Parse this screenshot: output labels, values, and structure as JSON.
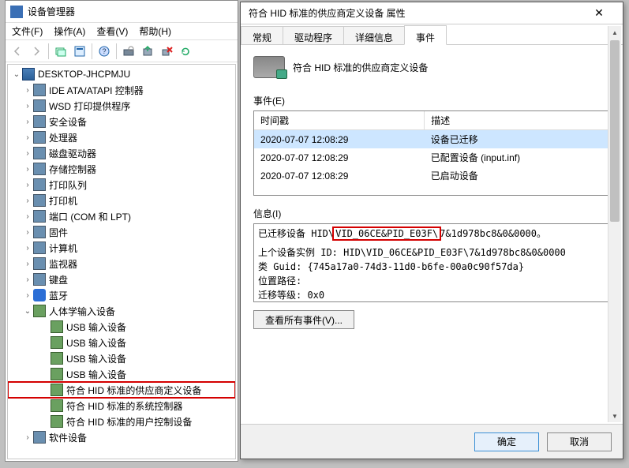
{
  "dm": {
    "title": "设备管理器",
    "menu": {
      "file": "文件(F)",
      "action": "操作(A)",
      "view": "查看(V)",
      "help": "帮助(H)"
    },
    "root": "DESKTOP-JHCPMJU",
    "categories": [
      {
        "label": "IDE ATA/ATAPI 控制器",
        "expand": "›"
      },
      {
        "label": "WSD 打印提供程序",
        "expand": "›"
      },
      {
        "label": "安全设备",
        "expand": "›"
      },
      {
        "label": "处理器",
        "expand": "›"
      },
      {
        "label": "磁盘驱动器",
        "expand": "›"
      },
      {
        "label": "存储控制器",
        "expand": "›"
      },
      {
        "label": "打印队列",
        "expand": "›"
      },
      {
        "label": "打印机",
        "expand": "›"
      },
      {
        "label": "端口 (COM 和 LPT)",
        "expand": "›"
      },
      {
        "label": "固件",
        "expand": "›"
      },
      {
        "label": "计算机",
        "expand": "›"
      },
      {
        "label": "监视器",
        "expand": "›"
      },
      {
        "label": "键盘",
        "expand": "›"
      },
      {
        "label": "蓝牙",
        "expand": "›"
      },
      {
        "label": "人体学输入设备",
        "expand": "⌄"
      },
      {
        "label": "软件设备",
        "expand": "›"
      }
    ],
    "hid_children": [
      "USB 输入设备",
      "USB 输入设备",
      "USB 输入设备",
      "USB 输入设备",
      "符合 HID 标准的供应商定义设备",
      "符合 HID 标准的系统控制器",
      "符合 HID 标准的用户控制设备"
    ]
  },
  "prop": {
    "title": "符合 HID 标准的供应商定义设备 属性",
    "tabs": {
      "general": "常规",
      "driver": "驱动程序",
      "details": "详细信息",
      "events": "事件"
    },
    "device_name": "符合 HID 标准的供应商定义设备",
    "events_label": "事件(E)",
    "events_cols": {
      "time": "时间戳",
      "desc": "描述"
    },
    "events_rows": [
      {
        "time": "2020-07-07 12:08:29",
        "desc": "设备已迁移"
      },
      {
        "time": "2020-07-07 12:08:29",
        "desc": "已配置设备 (input.inf)"
      },
      {
        "time": "2020-07-07 12:08:29",
        "desc": "已启动设备"
      }
    ],
    "info_label": "信息(I)",
    "info": {
      "line1a": "已迁移设备 HID\\",
      "line1_hl": "VID_06CE&PID_E03F\\",
      "line1b": "7&1d978bc8&0&0000。",
      "line2": "上个设备实例 ID: HID\\VID_06CE&PID_E03F\\7&1d978bc8&0&0000",
      "line3": "类 Guid: {745a17a0-74d3-11d0-b6fe-00a0c90f57da}",
      "line4": "位置路径:",
      "line5": "迁移等级: 0x0"
    },
    "view_all": "查看所有事件(V)...",
    "ok": "确定",
    "cancel": "取消"
  }
}
